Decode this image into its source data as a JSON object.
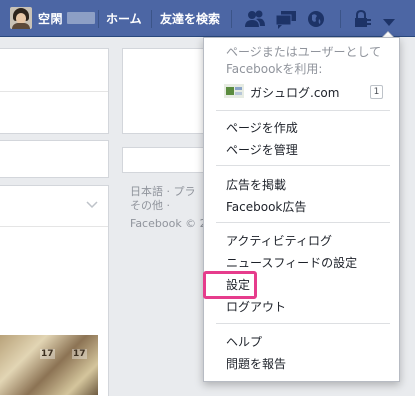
{
  "topbar": {
    "user_name": "空閑",
    "home_label": "ホーム",
    "find_friends_label": "友達を検索",
    "icons": [
      "friend-requests-icon",
      "messages-icon",
      "notifications-icon",
      "privacy-shortcuts-icon",
      "account-menu-icon"
    ]
  },
  "menu": {
    "header": "ページまたはユーザーとしてFacebookを利用:",
    "page": {
      "name": "ガシュログ.com",
      "badge": "1"
    },
    "items": {
      "create_page": "ページを作成",
      "manage_pages": "ページを管理",
      "advertise": "広告を掲載",
      "fb_ads": "Facebook広告",
      "activity_log": "アクティビティログ",
      "news_feed_prefs": "ニュースフィードの設定",
      "settings": "設定",
      "logout": "ログアウト",
      "help": "ヘルプ",
      "report": "問題を報告"
    }
  },
  "background": {
    "footer_line1": "日本語 · プラ",
    "footer_line2": "その他 ·",
    "footer_line3": "Facebook © 2",
    "thumb_label_a": "17",
    "thumb_label_b": "17"
  },
  "colors": {
    "topbar": "#4c66a4",
    "highlight": "#e63c8c"
  }
}
